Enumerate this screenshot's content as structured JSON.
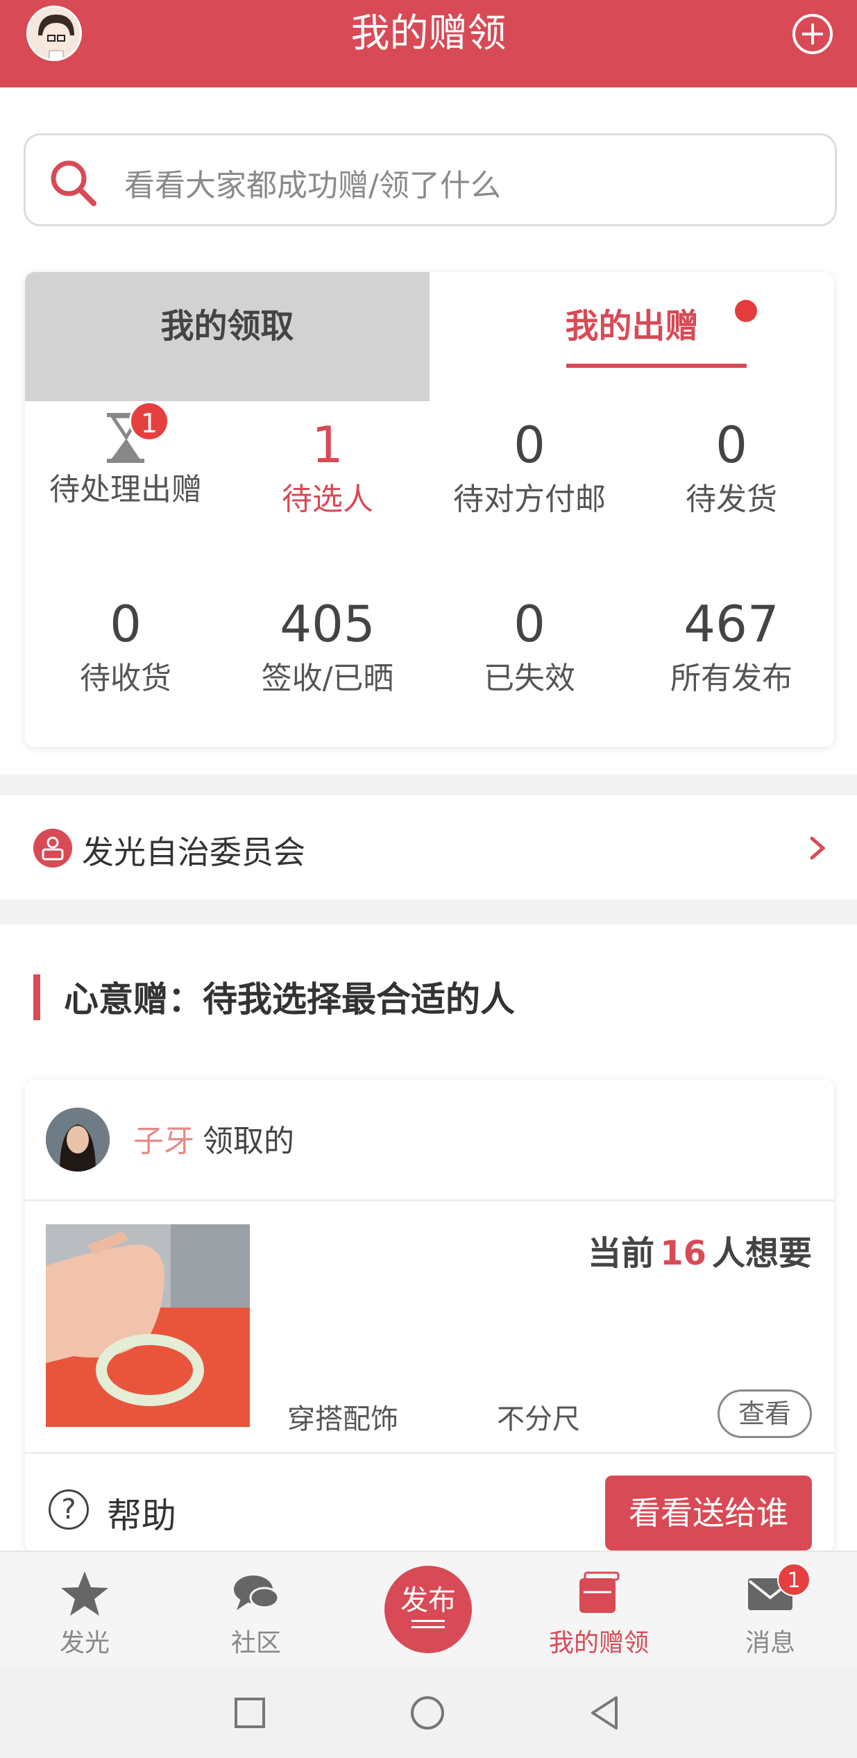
{
  "header": {
    "title": "我的赠领"
  },
  "search": {
    "placeholder": "看看大家都成功赠/领了什么"
  },
  "tabs": [
    {
      "label": "我的领取",
      "active": false
    },
    {
      "label": "我的出赠",
      "active": true,
      "has_dot": true
    }
  ],
  "stats": [
    {
      "value": "",
      "label": "待处理出赠",
      "icon": "hourglass-icon",
      "badge": "1"
    },
    {
      "value": "1",
      "label": "待选人",
      "active": true
    },
    {
      "value": "0",
      "label": "待对方付邮"
    },
    {
      "value": "0",
      "label": "待发货"
    },
    {
      "value": "0",
      "label": "待收货"
    },
    {
      "value": "405",
      "label": "签收/已晒"
    },
    {
      "value": "0",
      "label": "已失效"
    },
    {
      "value": "467",
      "label": "所有发布"
    }
  ],
  "committee": {
    "label": "发光自治委员会"
  },
  "section": {
    "title": "心意赠：待我选择最合适的人"
  },
  "item": {
    "user_name": "子牙",
    "user_suffix": "领取的",
    "want_prefix": "当前",
    "want_count": "16",
    "want_suffix": "人想要",
    "category": "穿搭配饰",
    "size": "不分尺",
    "view_label": "查看",
    "help_label": "帮助",
    "cta_label": "看看送给谁"
  },
  "bottom_nav": [
    {
      "label": "发光",
      "icon": "star-icon"
    },
    {
      "label": "社区",
      "icon": "chat-bubble-icon"
    },
    {
      "label": "发布",
      "icon": "publish-icon"
    },
    {
      "label": "我的赠领",
      "icon": "gift-box-icon",
      "active": true
    },
    {
      "label": "消息",
      "icon": "mail-icon",
      "badge": "1"
    }
  ],
  "colors": {
    "accent": "#d84a55",
    "badge": "#e5403f",
    "bg_gray": "#f2f2f2"
  }
}
